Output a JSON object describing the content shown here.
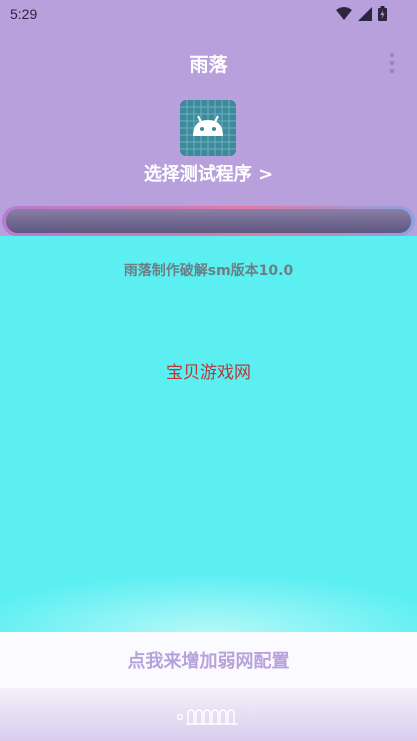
{
  "status_bar": {
    "time": "5:29",
    "icons": [
      "wifi-icon",
      "signal-icon",
      "battery-icon"
    ]
  },
  "header": {
    "title": "雨落",
    "menu_icon": "more-vert-icon",
    "app_icon": "android-icon",
    "select_program_label": "选择测试程序 >"
  },
  "progress": {
    "value": 1.0
  },
  "content": {
    "version_text": "雨落制作破解sm版本10.0",
    "watermark": "宝贝游戏网"
  },
  "footer": {
    "add_config_label": "点我来增加弱网配置"
  },
  "colors": {
    "header_bg": "#b8a0dd",
    "content_bg": "#5beff2",
    "accent": "#b7a2dc"
  }
}
